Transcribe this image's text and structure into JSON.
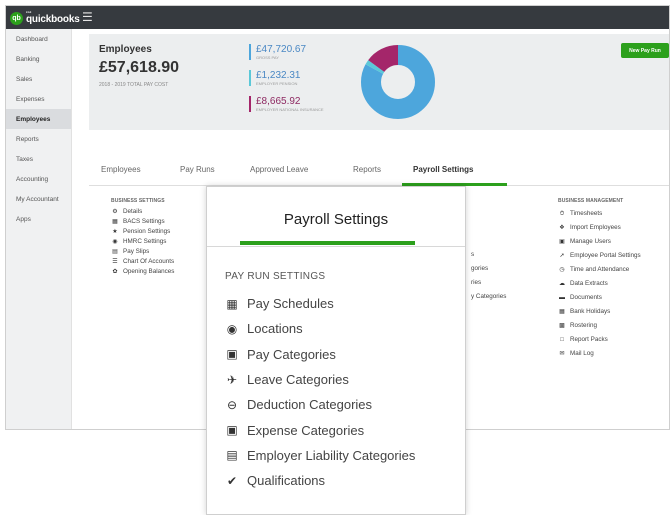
{
  "app": {
    "logo_small": "intuit",
    "logo_text": "quickbooks"
  },
  "sidebar": {
    "items": [
      {
        "label": "Dashboard"
      },
      {
        "label": "Banking"
      },
      {
        "label": "Sales"
      },
      {
        "label": "Expenses"
      },
      {
        "label": "Employees",
        "active": true
      },
      {
        "label": "Reports"
      },
      {
        "label": "Taxes"
      },
      {
        "label": "Accounting"
      },
      {
        "label": "My Accountant"
      },
      {
        "label": "Apps"
      }
    ]
  },
  "summary": {
    "title": "Employees",
    "amount": "£57,618.90",
    "subtitle": "2018 - 2019 TOTAL PAY COST",
    "stats": [
      {
        "value": "£47,720.67",
        "label": "GROSS PAY",
        "color": "#4da6dc"
      },
      {
        "value": "£1,232.31",
        "label": "EMPLOYER PENSION",
        "color": "#5bc8d8"
      },
      {
        "value": "£8,665.92",
        "label": "EMPLOYER NATIONAL INSURANCE",
        "color": "#a4266a"
      }
    ],
    "donut": {
      "segments": [
        {
          "value": 47720.67,
          "color": "#4da6dc"
        },
        {
          "value": 1232.31,
          "color": "#5bc8d8"
        },
        {
          "value": 8665.92,
          "color": "#a4266a"
        }
      ]
    },
    "new_pay_run": "New Pay Run"
  },
  "tabs": [
    {
      "label": "Employees"
    },
    {
      "label": "Pay Runs"
    },
    {
      "label": "Approved Leave"
    },
    {
      "label": "Reports"
    },
    {
      "label": "Payroll Settings",
      "active": true
    }
  ],
  "business_settings": {
    "heading": "BUSINESS SETTINGS",
    "items": [
      {
        "label": "Details",
        "icon": "gear-icon"
      },
      {
        "label": "BACS Settings",
        "icon": "bank-icon"
      },
      {
        "label": "Pension Settings",
        "icon": "star-icon"
      },
      {
        "label": "HMRC Settings",
        "icon": "globe-icon"
      },
      {
        "label": "Pay Slips",
        "icon": "document-icon"
      },
      {
        "label": "Chart Of Accounts",
        "icon": "list-icon"
      },
      {
        "label": "Opening Balances",
        "icon": "leaf-icon"
      }
    ]
  },
  "obscured_fragments": [
    {
      "text": "s"
    },
    {
      "text": "gories"
    },
    {
      "text": "ries"
    },
    {
      "text": "y Categories"
    }
  ],
  "business_management": {
    "heading": "BUSINESS MANAGEMENT",
    "items": [
      {
        "label": "Timesheets",
        "icon": "clock-icon"
      },
      {
        "label": "Import Employees",
        "icon": "users-icon"
      },
      {
        "label": "Manage Users",
        "icon": "lock-icon"
      },
      {
        "label": "Employee Portal Settings",
        "icon": "wrench-icon"
      },
      {
        "label": "Time and Attendance",
        "icon": "stopwatch-icon"
      },
      {
        "label": "Data Extracts",
        "icon": "cloud-icon"
      },
      {
        "label": "Documents",
        "icon": "folder-icon"
      },
      {
        "label": "Bank Holidays",
        "icon": "calendar-icon"
      },
      {
        "label": "Rostering",
        "icon": "calendar-check-icon"
      },
      {
        "label": "Report Packs",
        "icon": "folder-open-icon"
      },
      {
        "label": "Mail Log",
        "icon": "mail-icon"
      }
    ]
  },
  "popup": {
    "title": "Payroll Settings",
    "heading": "PAY RUN SETTINGS",
    "items": [
      {
        "label": "Pay Schedules",
        "icon": "calendar-icon"
      },
      {
        "label": "Locations",
        "icon": "globe-icon"
      },
      {
        "label": "Pay Categories",
        "icon": "money-icon"
      },
      {
        "label": "Leave Categories",
        "icon": "plane-icon"
      },
      {
        "label": "Deduction Categories",
        "icon": "minus-circle-icon"
      },
      {
        "label": "Expense Categories",
        "icon": "archive-icon"
      },
      {
        "label": "Employer Liability Categories",
        "icon": "factory-icon"
      },
      {
        "label": "Qualifications",
        "icon": "check-icon"
      }
    ]
  }
}
